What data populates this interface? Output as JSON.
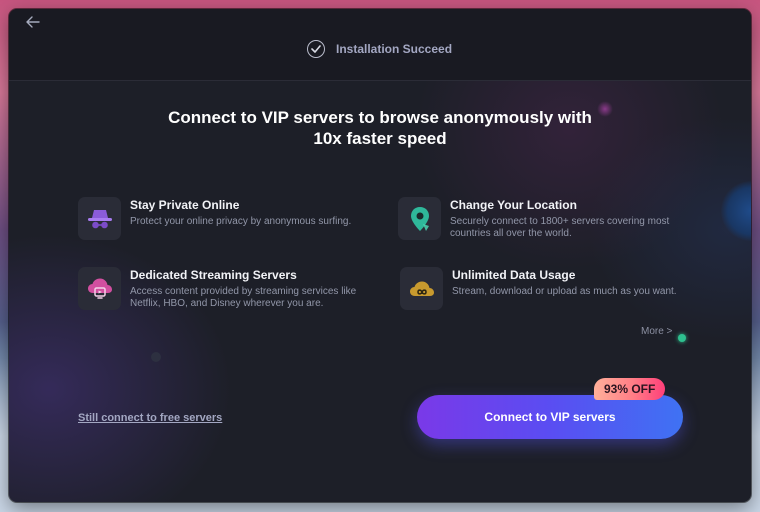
{
  "header": {
    "back_icon": "arrow-left-icon",
    "status_icon": "check-circle-icon",
    "status_text": "Installation Succeed"
  },
  "headline": {
    "line1": "Connect to VIP servers to browse anonymously with",
    "line2": "10x faster speed"
  },
  "features": [
    {
      "icon": "incognito-icon",
      "title": "Stay Private Online",
      "description": "Protect your online privacy by anonymous surfing."
    },
    {
      "icon": "location-pin-icon",
      "title": "Change Your Location",
      "description_line1": "Securely connect to 1800+ servers covering most",
      "description_line2": "countries all over the world."
    },
    {
      "icon": "streaming-cloud-icon",
      "title": "Dedicated Streaming Servers",
      "description_line1": "Access content provided by streaming services like",
      "description_line2": "Netflix, HBO, and Disney wherever you are."
    },
    {
      "icon": "infinity-cloud-icon",
      "title": "Unlimited Data Usage",
      "description": "Stream, download or upload as much as you want."
    }
  ],
  "more_link": "More >",
  "free_link": "Still connect to free servers",
  "vip_button": "Connect to VIP servers",
  "discount_badge": "93% OFF",
  "colors": {
    "accent_purple": "#7a39e8",
    "accent_blue": "#3f72f3",
    "badge_pink": "#ff5a80",
    "window_bg": "#1d1f28"
  }
}
